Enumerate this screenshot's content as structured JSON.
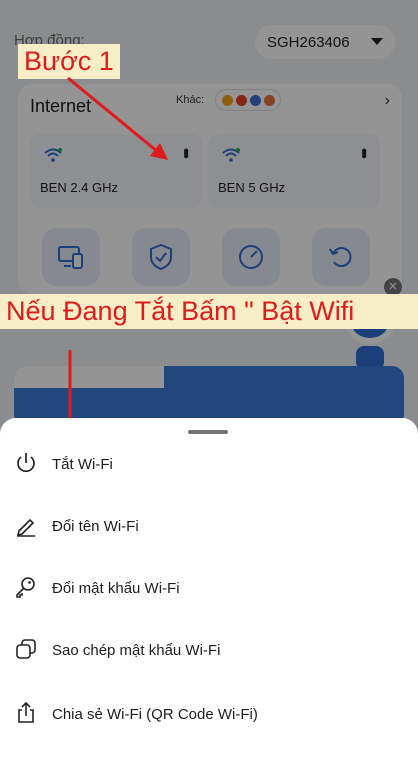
{
  "contract": {
    "label": "Hợp đồng:",
    "selected": "SGH263406"
  },
  "internet": {
    "title": "Internet",
    "other_label": "Khác:",
    "networks": [
      {
        "name": "BEN 2.4 GHz"
      },
      {
        "name": "BEN 5 GHz"
      }
    ]
  },
  "annotations": {
    "step": "Bước 1",
    "note": "Nếu Đang Tắt Bấm \" Bật Wifi"
  },
  "sheet": {
    "items": [
      {
        "label": "Tắt Wi-Fi",
        "icon": "power-icon"
      },
      {
        "label": "Đổi tên Wi-Fi",
        "icon": "pencil-icon"
      },
      {
        "label": "Đổi mật khẩu Wi-Fi",
        "icon": "key-icon"
      },
      {
        "label": "Sao chép mật khẩu Wi-Fi",
        "icon": "copy-icon"
      },
      {
        "label": "Chia sẻ Wi-Fi (QR Code Wi-Fi)",
        "icon": "share-icon"
      }
    ]
  },
  "colors": {
    "accent": "#2f6fd1",
    "annotation_text": "#e01b1b",
    "annotation_bg": "#f7edc6"
  }
}
